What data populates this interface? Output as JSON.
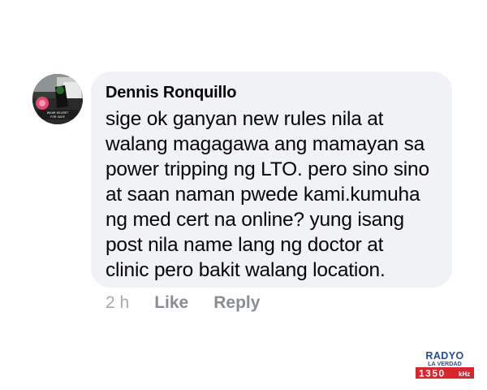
{
  "comment": {
    "author": "Dennis Ronquillo",
    "text": "sige ok ganyan new rules nila at walang magagawa ang mamayan sa power tripping ng LTO. pero sino sino at saan naman pwede kami.kumuha ng med cert na online? yung isang post nila name lang ng doctor at clinic pero bakit walang location.",
    "lines": [
      "sige ok ganyan new rules nila at",
      "walang magagawa ang mamayan sa",
      "power tripping ng LTO. pero sino sino",
      "at saan naman pwede kami.kumuha",
      "ng med cert na online? yung isang",
      "post nila name lang ng doctor at",
      "clinic pero bakit walang location."
    ],
    "avatar_caption": "WEAR HELMET FOR SAFE",
    "time": "2 h",
    "like_label": "Like",
    "reply_label": "Reply"
  },
  "brand": {
    "line1": "RADYO",
    "line2": "LA VERDAD",
    "freq": "1350",
    "unit": "kHz"
  },
  "colors": {
    "bubble": "#f0f2f5",
    "text": "#050505",
    "meta": "#8a8d91",
    "brand_blue": "#1f4e9c",
    "brand_red": "#d8262f"
  }
}
